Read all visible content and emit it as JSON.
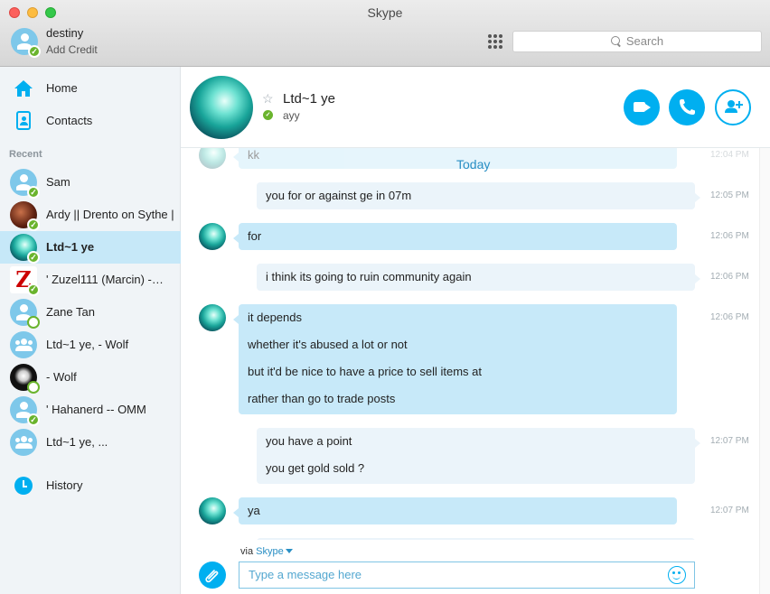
{
  "app": {
    "title": "Skype"
  },
  "profile": {
    "name": "destiny",
    "credit_label": "Add Credit"
  },
  "search": {
    "placeholder": "Search"
  },
  "sidebar": {
    "nav": [
      {
        "label": "Home"
      },
      {
        "label": "Contacts"
      }
    ],
    "recent_heading": "Recent",
    "contacts": [
      {
        "name": "Sam",
        "avatar": "default",
        "status": "online"
      },
      {
        "name": "Ardy || Drento on Sythe ||",
        "avatar": "photo",
        "status": "online"
      },
      {
        "name": "Ltd~1 ye",
        "avatar": "photo",
        "status": "online",
        "active": true
      },
      {
        "name": "' Zuzel111 (Marcin) -…",
        "avatar": "photo",
        "status": "online"
      },
      {
        "name": "Zane Tan",
        "avatar": "default",
        "status": "away"
      },
      {
        "name": "Ltd~1 ye, - Wolf",
        "avatar": "group",
        "status": "none"
      },
      {
        "name": "- Wolf",
        "avatar": "photo",
        "status": "away"
      },
      {
        "name": "' Hahanerd -- OMM",
        "avatar": "default",
        "status": "online"
      },
      {
        "name": "Ltd~1 ye, ...",
        "avatar": "group",
        "status": "none"
      }
    ],
    "history_label": "History"
  },
  "conversation": {
    "name": "Ltd~1 ye",
    "mood": "ayy",
    "status": "online",
    "actions": [
      "video-call",
      "audio-call",
      "add-people"
    ]
  },
  "messages": {
    "date_divider": "Today",
    "items": [
      {
        "direction": "in",
        "lines": [
          "kk"
        ],
        "time": "12:04 PM",
        "clipped": true
      },
      {
        "direction": "out",
        "lines": [
          "you for or against ge in 07m"
        ],
        "time": "12:05 PM"
      },
      {
        "direction": "in",
        "lines": [
          "for"
        ],
        "time": "12:06 PM"
      },
      {
        "direction": "out",
        "lines": [
          "i think its going to ruin community again"
        ],
        "time": "12:06 PM"
      },
      {
        "direction": "in",
        "lines": [
          "it depends",
          "whether it's abused a lot or not",
          "but it'd be nice to have a price to sell items at",
          "rather than go to trade posts"
        ],
        "time": "12:06 PM"
      },
      {
        "direction": "out",
        "lines": [
          "you have a point",
          "you get gold sold ?"
        ],
        "time": "12:07 PM"
      },
      {
        "direction": "in",
        "lines": [
          "ya"
        ],
        "time": "12:07 PM"
      }
    ]
  },
  "composer": {
    "via_prefix": "via",
    "via_service": "Skype",
    "placeholder": "Type a message here"
  },
  "colors": {
    "accent": "#00aff0",
    "incoming_bubble": "#c7e9f9",
    "outgoing_bubble": "#ebf4fa",
    "online": "#6ab42d"
  }
}
